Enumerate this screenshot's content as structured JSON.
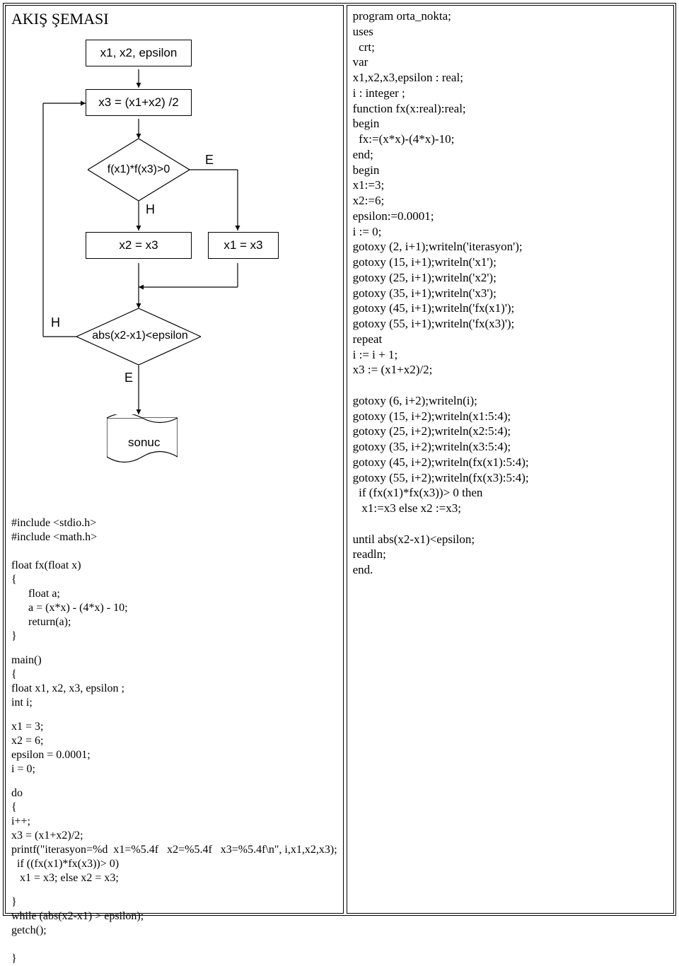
{
  "left": {
    "title": "AKIŞ ŞEMASI",
    "flow": {
      "input": "x1, x2, epsilon",
      "step1": "x3 = (x1+x2) /2",
      "cond1": "f(x1)*f(x3)>0",
      "cond1_true": "H",
      "cond1_false": "E",
      "left_box": "x2 = x3",
      "right_box": "x1 = x3",
      "cond2": "abs(x2-x1)<epsilon",
      "cond2_true": "E",
      "cond2_false": "H",
      "result": "sonuc"
    },
    "c_code_1": "#include <stdio.h>\n#include <math.h>\n\nfloat fx(float x)\n{\n      float a;\n      a = (x*x) - (4*x) - 10;\n      return(a);\n}",
    "c_code_2": "main()\n{\nfloat x1, x2, x3, epsilon ;\nint i;",
    "c_code_3": "x1 = 3;\nx2 = 6;\nepsilon = 0.0001;\ni = 0;",
    "c_code_4": "do\n{\ni++;\nx3 = (x1+x2)/2;\nprintf(\"iterasyon=%d  x1=%5.4f   x2=%5.4f   x3=%5.4f\\n\", i,x1,x2,x3);\n  if ((fx(x1)*fx(x3))> 0)\n   x1 = x3; else x2 = x3;",
    "c_code_5": "}\nwhile (abs(x2-x1) > epsilon);\ngetch();\n\n}"
  },
  "right": {
    "pascal_code": "program orta_nokta;\nuses\n  crt;\nvar\nx1,x2,x3,epsilon : real;\ni : integer ;\nfunction fx(x:real):real;\nbegin\n  fx:=(x*x)-(4*x)-10;\nend;\nbegin\nx1:=3;\nx2:=6;\nepsilon:=0.0001;\ni := 0;\ngotoxy (2, i+1);writeln('iterasyon');\ngotoxy (15, i+1);writeln('x1');\ngotoxy (25, i+1);writeln('x2');\ngotoxy (35, i+1);writeln('x3');\ngotoxy (45, i+1);writeln('fx(x1)');\ngotoxy (55, i+1);writeln('fx(x3)');\nrepeat\ni := i + 1;\nx3 := (x1+x2)/2;\n\ngotoxy (6, i+2);writeln(i);\ngotoxy (15, i+2);writeln(x1:5:4);\ngotoxy (25, i+2);writeln(x2:5:4);\ngotoxy (35, i+2);writeln(x3:5:4);\ngotoxy (45, i+2);writeln(fx(x1):5:4);\ngotoxy (55, i+2);writeln(fx(x3):5:4);\n  if (fx(x1)*fx(x3))> 0 then\n   x1:=x3 else x2 :=x3;\n\nuntil abs(x2-x1)<epsilon;\nreadln;\nend."
  }
}
